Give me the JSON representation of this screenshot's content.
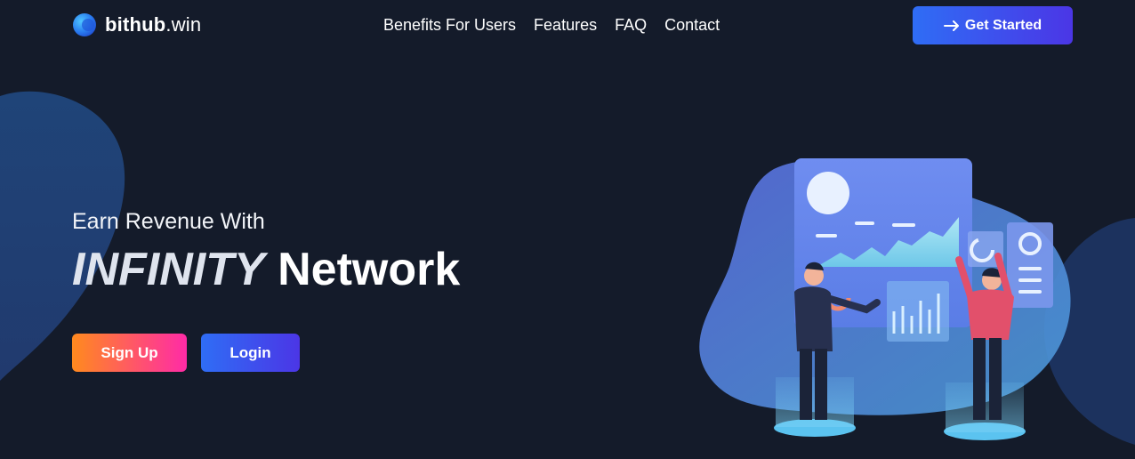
{
  "brand": {
    "name": "bithub",
    "tld": ".win",
    "logo_icon": "blue-sphere-logo-icon"
  },
  "nav": {
    "items": [
      {
        "label": "Benefits For Users"
      },
      {
        "label": "Features"
      },
      {
        "label": "FAQ"
      },
      {
        "label": "Contact"
      }
    ]
  },
  "header": {
    "cta_label": "Get Started",
    "cta_icon": "arrow-right-icon"
  },
  "hero": {
    "subtitle": "Earn Revenue With",
    "title_accent": "INFINITY",
    "title_main": "Network",
    "signup_label": "Sign Up",
    "login_label": "Login",
    "illustration": "analytics-dashboard-people-illustration"
  },
  "colors": {
    "background": "#141b2a",
    "primary_gradient": [
      "#2f6df5",
      "#4b36e6"
    ],
    "signup_gradient": [
      "#ff8a1e",
      "#ff2ba6"
    ],
    "blob": "#1e3a6a"
  }
}
